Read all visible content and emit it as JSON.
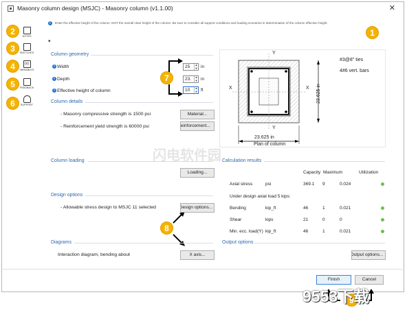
{
  "window": {
    "title": "Masonry column design (MSJC) - Masonry column (v1.1.00)",
    "close_glyph": "✕",
    "info_text": "Enter the effective height of the column, NOT the overall clear height of the column. Be sure to consider all support conditions and loading scenarios in determination of the column effective height."
  },
  "sidebar": {
    "items": [
      {
        "label": "NOTES",
        "icon": "notes-icon"
      },
      {
        "label": "SKETCHES",
        "icon": "sketches-icon"
      },
      {
        "label": "VARIABLES",
        "icon": "variables-icon"
      },
      {
        "label": "FEEDBACK",
        "icon": "feedback-icon"
      },
      {
        "label": "SUPPORT",
        "icon": "headset-icon"
      }
    ]
  },
  "badges": [
    "1",
    "2",
    "3",
    "4",
    "5",
    "6",
    "7",
    "8",
    "9"
  ],
  "geometry": {
    "title": "Column geometry",
    "width_label": "Width",
    "width_value": "25",
    "width_unit": "in",
    "depth_label": "Depth",
    "depth_value": "23.",
    "depth_unit": "in",
    "height_label": "Effective height of column",
    "height_value": "10",
    "height_unit": "ft"
  },
  "details": {
    "title": "Column details",
    "masonry_text": "- Masonry compressive strength is 1500 psi",
    "material_btn": "Material...",
    "rebar_text": "- Reinforcement yield strength is 60000 psi",
    "reinforcement_btn": "Reinforcement..."
  },
  "loading": {
    "title": "Column loading",
    "loading_btn": "Loading..."
  },
  "design": {
    "title": "Design options",
    "text": "- Allowable stress design to MSJC 11 selected",
    "btn": "Design options..."
  },
  "diagrams": {
    "title": "Diagrams",
    "text": "Interaction diagram, bending about",
    "btn": "X axis..."
  },
  "results": {
    "title": "Calculation results",
    "headers": {
      "capacity": "Capacity",
      "maximum": "Maximum",
      "utilization": "Utilization"
    },
    "axial": {
      "name": "Axial stress",
      "unit": "psi",
      "capacity": "369.1",
      "maximum": "9",
      "util": "0.024"
    },
    "under_text": "Under design axial load 5 kips:",
    "rows": [
      {
        "name": "Bending",
        "unit": "kip_ft",
        "capacity": "46",
        "maximum": "1",
        "util": "0.021"
      },
      {
        "name": "Shear",
        "unit": "kips",
        "capacity": "21",
        "maximum": "0",
        "util": "0"
      },
      {
        "name": "Min. ecc. load(Y)",
        "unit": "kip_ft",
        "capacity": "46",
        "maximum": "1",
        "util": "0.021"
      }
    ]
  },
  "output": {
    "title": "Output options",
    "btn": "Output options..."
  },
  "footer": {
    "finish": "Finish",
    "cancel": "Cancel"
  },
  "plan": {
    "ties_text": "#3@8\" ties",
    "bars_text": "4#6 vert. bars",
    "dim_vertical": "23.625 in",
    "dim_horizontal": "23.625 in",
    "caption": "Plan of column",
    "axis_y": "Y",
    "axis_x": "X"
  },
  "watermark": {
    "main": "闪电软件园",
    "corner": "9553下载"
  },
  "colors": {
    "accent": "#2b67b1",
    "badge": "#f5b301",
    "ok": "#6cc04a",
    "info": "#1e6fd1"
  }
}
